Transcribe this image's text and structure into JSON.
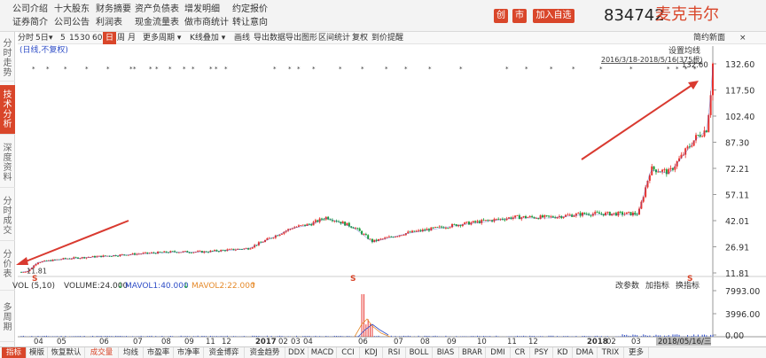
{
  "header": {
    "links": [
      [
        "公司介绍",
        "十大股东",
        "财务摘要",
        "资产负债表",
        "增发明细",
        "约定报价"
      ],
      [
        "证券简介",
        "公司公告",
        "利润表",
        "现金流量表",
        "做市商统计",
        "转让意向"
      ]
    ],
    "btn_chuang": "创",
    "btn_shi": "市",
    "btn_watch": "加入自选",
    "code": "834742",
    "name": "麦克韦尔"
  },
  "toolbar": {
    "items": [
      "分时",
      "5日",
      "▾",
      "5",
      "15",
      "30",
      "60",
      "日",
      "周",
      "月",
      "更多周期 ▾",
      "K线叠加 ▾",
      "画线",
      "导出数据",
      "导出图形",
      "区间统计",
      "复权",
      "到价提醒"
    ],
    "right": "简约新面",
    "close": "×",
    "active": "日"
  },
  "side": [
    {
      "label": "分时走势",
      "active": false
    },
    {
      "label": "技术分析",
      "active": true
    },
    {
      "label": "深度资料",
      "active": false
    },
    {
      "label": "分时成交",
      "active": false
    },
    {
      "label": "分价表",
      "active": false
    },
    {
      "label": "多周期",
      "active": false
    }
  ],
  "chart": {
    "adjust_note": "(日线,不复权)",
    "set_ma": "设置均线",
    "date_range": "2016/3/18-2018/5/16(375根)",
    "max_label": "132.60",
    "min_label": "11.81",
    "price_ticks": [
      "132.60",
      "117.50",
      "102.40",
      "87.30",
      "72.21",
      "57.11",
      "42.01",
      "26.91",
      "11.81"
    ],
    "x_labels": [
      "04",
      "05",
      "06",
      "07",
      "08",
      "09",
      "11",
      "12",
      "2017",
      "02",
      "03",
      "04",
      "06",
      "07",
      "08",
      "09",
      "10",
      "11",
      "12",
      "2018",
      "02",
      "03"
    ],
    "cursor_date": "2018/05/16/三",
    "markers": "S",
    "colors": {
      "up": "#e8322d",
      "down": "#1a9c3a",
      "accent": "#d9462a",
      "vol": "#2f4ec7",
      "ma1": "#2f4ec7",
      "ma2": "#e58a2a"
    }
  },
  "volume": {
    "title": "VOL (5,10)",
    "volume_label": "VOLUME:24.000",
    "mavol1": "MAVOL1:40.000",
    "mavol2": "MAVOL2:22.000",
    "right_btns": [
      "改参数",
      "加指标",
      "换指标"
    ],
    "ticks": [
      "7993.00",
      "3996.00",
      "0.00"
    ]
  },
  "tabs": {
    "items": [
      "指标",
      "模版",
      "恢复默认",
      "成交量",
      "均线",
      "市盈率",
      "市净率",
      "资金博弈",
      "资金趋势",
      "DDX",
      "MACD",
      "CCI",
      "KDJ",
      "RSI",
      "BOLL",
      "BIAS",
      "BRAR",
      "DMI",
      "CR",
      "PSY",
      "KD",
      "DMA",
      "TRIX",
      "更多"
    ],
    "active": "指标",
    "hot": "成交量"
  }
}
